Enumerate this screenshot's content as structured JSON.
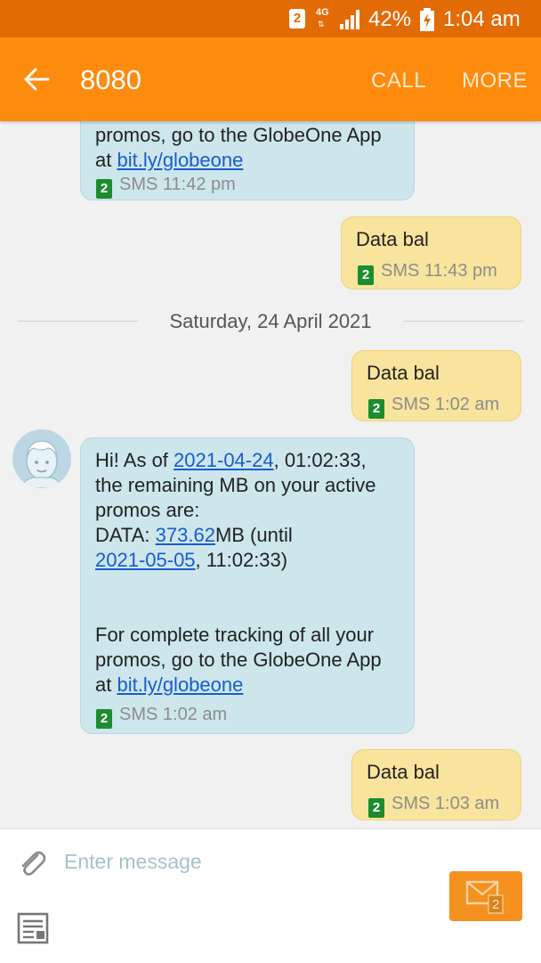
{
  "status_bar": {
    "sim_slot": "2",
    "network": "4G",
    "battery_percent": "42%",
    "time": "1:04 am"
  },
  "app_bar": {
    "title": "8080",
    "call_label": "CALL",
    "more_label": "MORE"
  },
  "conversation": {
    "date_separator": "Saturday, 24 April 2021",
    "messages": [
      {
        "direction": "incoming",
        "text_top": "promos, go to the GlobeOne App",
        "text_at": "at ",
        "link": "bit.ly/globeone",
        "sim": "2",
        "meta": "SMS 11:42 pm"
      },
      {
        "direction": "outgoing",
        "text": "Data bal",
        "sim": "2",
        "meta": "SMS 11:43 pm"
      },
      {
        "direction": "outgoing",
        "text": "Data bal",
        "sim": "2",
        "meta": "SMS 1:02 am"
      },
      {
        "direction": "incoming",
        "intro": "Hi! As of ",
        "date_link": "2021-04-24",
        "intro_time": ", 01:02:33,",
        "line2": "the remaining MB on your active",
        "line3": "promos are:",
        "data_label": "DATA: ",
        "data_value_link": "373.62",
        "data_unit": "MB (until",
        "until_link": "2021-05-05",
        "until_time": ", 11:02:33)",
        "line_tracking_1": "For complete tracking of all your",
        "line_tracking_2": "promos, go to the GlobeOne App",
        "text_at": "at ",
        "link": "bit.ly/globeone",
        "sim": "2",
        "meta": "SMS 1:02 am"
      },
      {
        "direction": "outgoing",
        "text": "Data bal",
        "sim": "2",
        "meta": "SMS 1:03 am"
      }
    ]
  },
  "composer": {
    "placeholder": "Enter message",
    "send_sim": "2"
  },
  "colors": {
    "status_bar": "#e36b06",
    "app_bar": "#fd8b0d",
    "incoming_bubble": "#cce6ec",
    "outgoing_bubble": "#f8e49c",
    "link": "#1a5ccf",
    "sim_badge": "#1c8d2e",
    "send_button": "#f4911f"
  }
}
